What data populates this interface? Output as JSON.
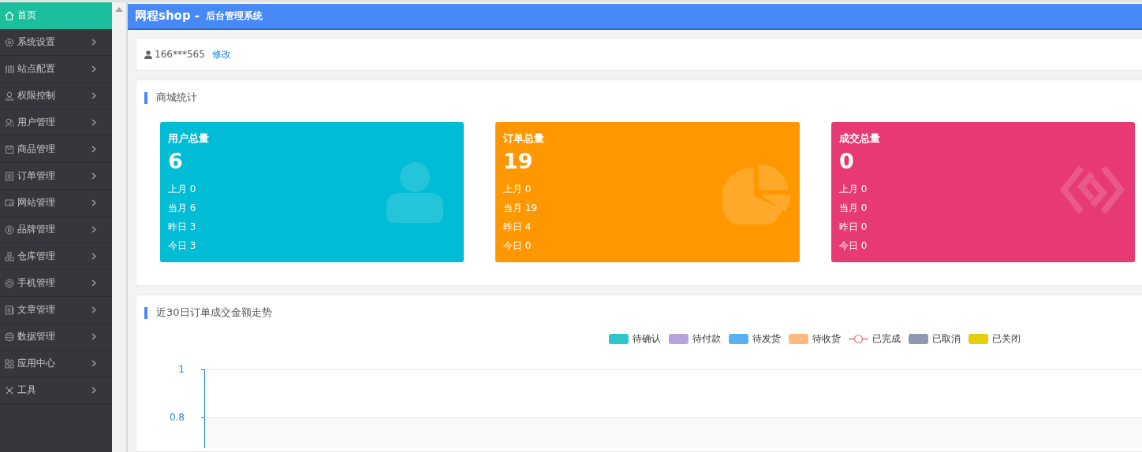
{
  "sidebar": {
    "items": [
      {
        "label": "首页",
        "selected": true,
        "has_submenu": false
      },
      {
        "label": "系统设置",
        "selected": false,
        "has_submenu": true
      },
      {
        "label": "站点配置",
        "selected": false,
        "has_submenu": true
      },
      {
        "label": "权限控制",
        "selected": false,
        "has_submenu": true
      },
      {
        "label": "用户管理",
        "selected": false,
        "has_submenu": true
      },
      {
        "label": "商品管理",
        "selected": false,
        "has_submenu": true
      },
      {
        "label": "订单管理",
        "selected": false,
        "has_submenu": true
      },
      {
        "label": "网站管理",
        "selected": false,
        "has_submenu": true
      },
      {
        "label": "品牌管理",
        "selected": false,
        "has_submenu": true
      },
      {
        "label": "仓库管理",
        "selected": false,
        "has_submenu": true
      },
      {
        "label": "手机管理",
        "selected": false,
        "has_submenu": true
      },
      {
        "label": "文章管理",
        "selected": false,
        "has_submenu": true
      },
      {
        "label": "数据管理",
        "selected": false,
        "has_submenu": true
      },
      {
        "label": "应用中心",
        "selected": false,
        "has_submenu": true
      },
      {
        "label": "工具",
        "selected": false,
        "has_submenu": true
      }
    ]
  },
  "header": {
    "brand": "网程shop -",
    "subtitle": "后台管理系统"
  },
  "user_bar": {
    "phone": "166***565",
    "edit_link": "修改"
  },
  "stats": {
    "title": "商城统计",
    "cards": [
      {
        "title": "用户总量",
        "total": "6",
        "kind": "user",
        "color": "#00bcd4",
        "lines": [
          "上月 0",
          "当月 6",
          "昨日 3",
          "今日 3"
        ]
      },
      {
        "title": "订单总量",
        "total": "19",
        "kind": "pie",
        "color": "#ff9800",
        "lines": [
          "上月 0",
          "当月 19",
          "昨日 4",
          "今日 0"
        ]
      },
      {
        "title": "成交总量",
        "total": "0",
        "kind": "deal",
        "color": "#e73a72",
        "lines": [
          "上月 0",
          "当月 0",
          "昨日 0",
          "今日 0"
        ]
      }
    ]
  },
  "trend": {
    "title": "近30日订单成交金额走势",
    "legend": [
      {
        "label": "待确认",
        "kind": "swatch",
        "color": "#2ec7c9"
      },
      {
        "label": "待付款",
        "kind": "swatch",
        "color": "#b6a2de"
      },
      {
        "label": "待发货",
        "kind": "swatch",
        "color": "#5ab1ef"
      },
      {
        "label": "待收货",
        "kind": "swatch",
        "color": "#ffb980"
      },
      {
        "label": "已完成",
        "kind": "line",
        "color": "#d87a80"
      },
      {
        "label": "已取消",
        "kind": "swatch",
        "color": "#8d98b3"
      },
      {
        "label": "已关闭",
        "kind": "swatch",
        "color": "#e5cf0d"
      }
    ],
    "y_ticks": [
      "1",
      "0.8"
    ]
  }
}
